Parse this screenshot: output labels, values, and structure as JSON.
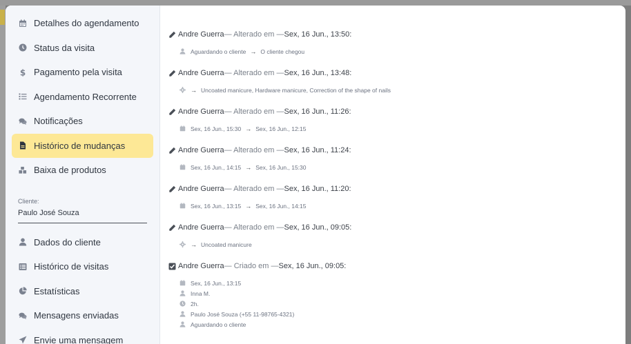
{
  "sidebar": {
    "items": [
      {
        "label": "Detalhes do agendamento",
        "icon": "calendar-icon"
      },
      {
        "label": "Status da visita",
        "icon": "clock-icon"
      },
      {
        "label": "Pagamento pela visita",
        "icon": "dollar-icon"
      },
      {
        "label": "Agendamento Recorrente",
        "icon": "list-icon"
      },
      {
        "label": "Notificações",
        "icon": "comments-icon"
      },
      {
        "label": "Histórico de mudanças",
        "icon": "file-icon",
        "active": true
      },
      {
        "label": "Baixa de produtos",
        "icon": "cubes-icon"
      }
    ],
    "client_label": "Cliente:",
    "client_value": "Paulo  José Souza",
    "items2": [
      {
        "label": "Dados do cliente",
        "icon": "user-icon"
      },
      {
        "label": "Histórico de visitas",
        "icon": "list-alt-icon"
      },
      {
        "label": "Estatísticas",
        "icon": "pie-chart-icon"
      },
      {
        "label": "Mensagens enviadas",
        "icon": "comments-icon"
      },
      {
        "label": "Envie uma mensagem",
        "icon": "send-icon"
      }
    ]
  },
  "history": {
    "entries": [
      {
        "author": "Andre Guerra",
        "action": " — Alterado em — ",
        "date": "Sex, 16 Jun., 13:50:",
        "lines": [
          {
            "icon": "user-icon",
            "from": "Aguardando o cliente",
            "to": "O cliente chegou"
          }
        ]
      },
      {
        "author": "Andre Guerra",
        "action": " — Alterado em — ",
        "date": "Sex, 16 Jun., 13:48:",
        "lines": [
          {
            "icon": "gear-icon",
            "from": "",
            "to": "Uncoated manicure, Hardware manicure, Correction of the shape of nails"
          }
        ]
      },
      {
        "author": "Andre Guerra",
        "action": " — Alterado em — ",
        "date": "Sex, 16 Jun., 11:26:",
        "lines": [
          {
            "icon": "calendar-icon",
            "from": "Sex, 16 Jun., 15:30",
            "to": "Sex, 16 Jun., 12:15"
          }
        ]
      },
      {
        "author": "Andre Guerra",
        "action": " — Alterado em — ",
        "date": "Sex, 16 Jun., 11:24:",
        "lines": [
          {
            "icon": "calendar-icon",
            "from": "Sex, 16 Jun., 14:15",
            "to": "Sex, 16 Jun., 15:30"
          }
        ]
      },
      {
        "author": "Andre Guerra",
        "action": " — Alterado em — ",
        "date": "Sex, 16 Jun., 11:20:",
        "lines": [
          {
            "icon": "calendar-icon",
            "from": "Sex, 16 Jun., 13:15",
            "to": "Sex, 16 Jun., 14:15"
          }
        ]
      },
      {
        "author": "Andre Guerra",
        "action": " — Alterado em — ",
        "date": "Sex, 16 Jun., 09:05:",
        "lines": [
          {
            "icon": "gear-icon",
            "from": "",
            "to": "Uncoated manicure"
          }
        ]
      }
    ],
    "created": {
      "author": "Andre Guerra",
      "action": " — Criado em — ",
      "date": "Sex, 16 Jun., 09:05:",
      "lines": [
        {
          "icon": "calendar-icon",
          "text": "Sex, 16 Jun., 13:15"
        },
        {
          "icon": "user-icon",
          "text": "Inna M."
        },
        {
          "icon": "clock-icon",
          "text": "2h."
        },
        {
          "icon": "user-icon",
          "text": "Paulo José Souza (+55 11-98765-4321)"
        },
        {
          "icon": "user-icon",
          "text": "Aguardando o cliente"
        }
      ]
    },
    "arrow": "→"
  }
}
